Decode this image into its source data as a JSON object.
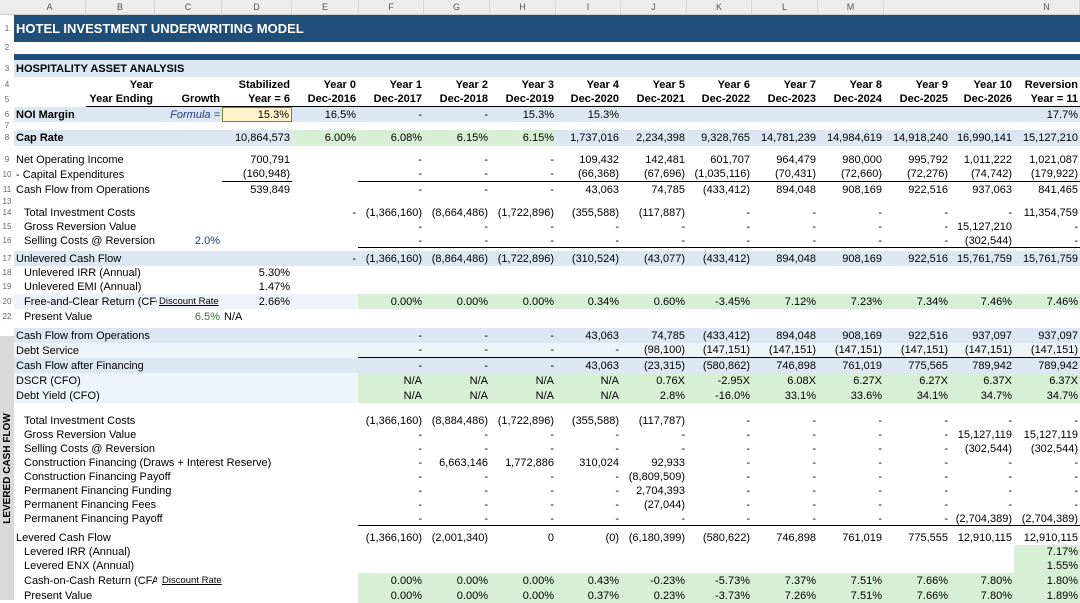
{
  "column_letters": [
    "A",
    "B",
    "C",
    "D",
    "E",
    "F",
    "G",
    "H",
    "I",
    "J",
    "K",
    "L",
    "M",
    "N"
  ],
  "title": "HOTEL INVESTMENT UNDERWRITING MODEL",
  "section_title": "HOSPITALITY ASSET ANALYSIS",
  "side_label": "LEVERED CASH FLOW",
  "header": {
    "year_label": "Year",
    "year_ending_label": "Year Ending",
    "growth_label": "Growth",
    "stabilized": [
      "Stabilized",
      "Year = 6"
    ],
    "years": [
      "Year 0",
      "Year 1",
      "Year 2",
      "Year 3",
      "Year 4",
      "Year 5",
      "Year 6",
      "Year 7",
      "Year 8",
      "Year 9",
      "Year 10"
    ],
    "dates": [
      "Dec-2016",
      "Dec-2017",
      "Dec-2018",
      "Dec-2019",
      "Dec-2020",
      "Dec-2021",
      "Dec-2022",
      "Dec-2023",
      "Dec-2024",
      "Dec-2025",
      "Dec-2026"
    ],
    "reversion": [
      "Reversion",
      "Year = 11"
    ]
  },
  "noi_margin": {
    "label": "NOI Margin",
    "formula": "Formula =",
    "stab": "15.3%",
    "values": [
      "16.5%",
      "-",
      "-",
      "15.3%",
      "15.3%",
      "",
      "",
      "",
      "",
      "",
      ""
    ],
    "rev": "17.7%"
  },
  "cap_rate": {
    "label": "Cap Rate",
    "stab": "10,864,573",
    "values": [
      "6.00%",
      "6.08%",
      "6.15%",
      "6.15%",
      "1,737,016",
      "2,234,398",
      "9,328,765",
      "14,781,239",
      "14,984,619",
      "14,918,240",
      "16,990,141"
    ],
    "rev": "15,127,210"
  },
  "rows_top": [
    {
      "label": "Net Operating Income",
      "stab": "700,791",
      "values": [
        "",
        "-",
        "-",
        "-",
        "109,432",
        "142,481",
        "601,707",
        "964,479",
        "980,000",
        "995,792",
        "1,011,222"
      ],
      "rev": "1,021,087"
    },
    {
      "label": "  - Capital Expenditures",
      "stab": "(160,948)",
      "values": [
        "",
        "-",
        "-",
        "-",
        "(66,368)",
        "(67,696)",
        "(1,035,116)",
        "(70,431)",
        "(72,660)",
        "(72,276)",
        "(74,742)"
      ],
      "rev": "(179,922)"
    },
    {
      "label": "Cash Flow from Operations",
      "stab": "539,849",
      "values": [
        "",
        "-",
        "-",
        "-",
        "43,063",
        "74,785",
        "(433,412)",
        "894,048",
        "908,169",
        "922,516",
        "937,063"
      ],
      "rev": "841,465"
    }
  ],
  "rows_inv": [
    {
      "label": "Total Investment Costs",
      "values": [
        "-",
        "(1,366,160)",
        "(8,664,486)",
        "(1,722,896)",
        "(355,588)",
        "(117,887)",
        "-",
        "-",
        "-",
        "-",
        "-"
      ],
      "rev": "11,354,759"
    },
    {
      "label": "Gross Reversion Value",
      "values": [
        "",
        "-",
        "-",
        "-",
        "-",
        "-",
        "-",
        "-",
        "-",
        "-",
        "15,127,210"
      ],
      "rev": "-"
    },
    {
      "label": "Selling Costs @ Reversion",
      "growth": "2.0%",
      "values": [
        "",
        "-",
        "-",
        "-",
        "-",
        "-",
        "-",
        "-",
        "-",
        "-",
        "(302,544)"
      ],
      "rev": "-"
    }
  ],
  "unlevered_cf": {
    "label": "Unlevered Cash Flow",
    "values": [
      "-",
      "(1,366,160)",
      "(8,864,486)",
      "(1,722,896)",
      "(310,524)",
      "(43,077)",
      "(433,412)",
      "894,048",
      "908,169",
      "922,516",
      "15,761,759"
    ],
    "rev": "15,761,759"
  },
  "unlevered_irr": {
    "label": "Unlevered IRR (Annual)",
    "value": "5.30%"
  },
  "unlevered_emi": {
    "label": "Unlevered EMI (Annual)",
    "value": "1.47%"
  },
  "free_clear": {
    "label": "Free-and-Clear Return (CFO)",
    "link": "Discount Rate",
    "stab": "2.66%",
    "values": [
      "",
      "0.00%",
      "0.00%",
      "0.00%",
      "0.34%",
      "0.60%",
      "-3.45%",
      "7.12%",
      "7.23%",
      "7.34%",
      "7.46%"
    ],
    "rev": "7.46%"
  },
  "present_value": {
    "label": "Present Value",
    "rate": "6.5%",
    "value": "N/A"
  },
  "rows_fin": [
    {
      "label": "Cash Flow from Operations",
      "values": [
        "",
        "-",
        "-",
        "-",
        "43,063",
        "74,785",
        "(433,412)",
        "894,048",
        "908,169",
        "922,516",
        "937,097"
      ],
      "rev": "937,097"
    },
    {
      "label": "  Debt Service",
      "values": [
        "",
        "-",
        "-",
        "-",
        "-",
        "(98,100)",
        "(147,151)",
        "(147,151)",
        "(147,151)",
        "(147,151)",
        "(147,151)"
      ],
      "rev": "(147,151)"
    },
    {
      "label": "Cash Flow after Financing",
      "values": [
        "",
        "-",
        "-",
        "-",
        "43,063",
        "(23,315)",
        "(580,862)",
        "746,898",
        "761,019",
        "775,565",
        "789,942"
      ],
      "rev": "789,942"
    },
    {
      "label": "  DSCR (CFO)",
      "values": [
        "",
        "N/A",
        "N/A",
        "N/A",
        "N/A",
        "0.76X",
        "-2.95X",
        "6.08X",
        "6.27X",
        "6.27X",
        "6.37X"
      ],
      "rev": "6.37X"
    },
    {
      "label": "  Debt Yield (CFO)",
      "values": [
        "",
        "N/A",
        "N/A",
        "N/A",
        "N/A",
        "2.8%",
        "-16.0%",
        "33.1%",
        "33.6%",
        "34.1%",
        "34.7%"
      ],
      "rev": "34.7%"
    }
  ],
  "rows_lev": [
    {
      "label": "Total Investment Costs",
      "values": [
        "",
        "(1,366,160)",
        "(8,884,486)",
        "(1,722,896)",
        "(355,588)",
        "(117,787)",
        "-",
        "-",
        "-",
        "-",
        "-"
      ],
      "rev": "-"
    },
    {
      "label": "Gross Reversion Value",
      "values": [
        "",
        "-",
        "-",
        "-",
        "-",
        "-",
        "-",
        "-",
        "-",
        "-",
        "15,127,119"
      ],
      "rev": "15,127,119"
    },
    {
      "label": "Selling Costs @ Reversion",
      "values": [
        "",
        "-",
        "-",
        "-",
        "-",
        "-",
        "-",
        "-",
        "-",
        "-",
        "(302,544)"
      ],
      "rev": "(302,544)"
    },
    {
      "label": "Construction Financing (Draws + Interest Reserve)",
      "values": [
        "",
        "-",
        "6,663,146",
        "1,772,886",
        "310,024",
        "92,933",
        "-",
        "-",
        "-",
        "-",
        "-"
      ],
      "rev": "-"
    },
    {
      "label": "Construction Financing Payoff",
      "values": [
        "",
        "-",
        "-",
        "-",
        "-",
        "(8,809,509)",
        "-",
        "-",
        "-",
        "-",
        "-"
      ],
      "rev": "-"
    },
    {
      "label": "Permanent Financing Funding",
      "values": [
        "",
        "-",
        "-",
        "-",
        "-",
        "2,704,393",
        "-",
        "-",
        "-",
        "-",
        "-"
      ],
      "rev": "-"
    },
    {
      "label": "Permanent Financing Fees",
      "values": [
        "",
        "-",
        "-",
        "-",
        "-",
        "(27,044)",
        "-",
        "-",
        "-",
        "-",
        "-"
      ],
      "rev": "-"
    },
    {
      "label": "Permanent Financing Payoff",
      "values": [
        "",
        "-",
        "-",
        "-",
        "-",
        "-",
        "-",
        "-",
        "-",
        "-",
        "(2,704,389)"
      ],
      "rev": "(2,704,389)"
    }
  ],
  "levered_cf": {
    "label": "Levered Cash Flow",
    "values": [
      "",
      "(1,366,160)",
      "(2,001,340)",
      "0",
      "(0)",
      "(6,180,399)",
      "(580,622)",
      "746,898",
      "761,019",
      "775,555",
      "12,910,115"
    ],
    "rev": "12,910,115"
  },
  "levered_irr": {
    "label": "Levered IRR (Annual)",
    "rev": "7.17%"
  },
  "levered_enx": {
    "label": "Levered ENX (Annual)",
    "rev": "1.55%"
  },
  "coc": {
    "label": "Cash-on-Cash Return (CFAF)",
    "link": "Discount Rate",
    "values": [
      "",
      "0.00%",
      "0.00%",
      "0.00%",
      "0.43%",
      "-0.23%",
      "-5.73%",
      "7.37%",
      "7.51%",
      "7.66%",
      "7.80%"
    ],
    "rev": "1.80%"
  },
  "pv_lev": {
    "label": "Present Value",
    "values": [
      "",
      "0.00%",
      "0.00%",
      "0.00%",
      "0.37%",
      "0.23%",
      "-3.73%",
      "7.26%",
      "7.51%",
      "7.66%",
      "7.80%"
    ],
    "rev": "1.89%"
  }
}
